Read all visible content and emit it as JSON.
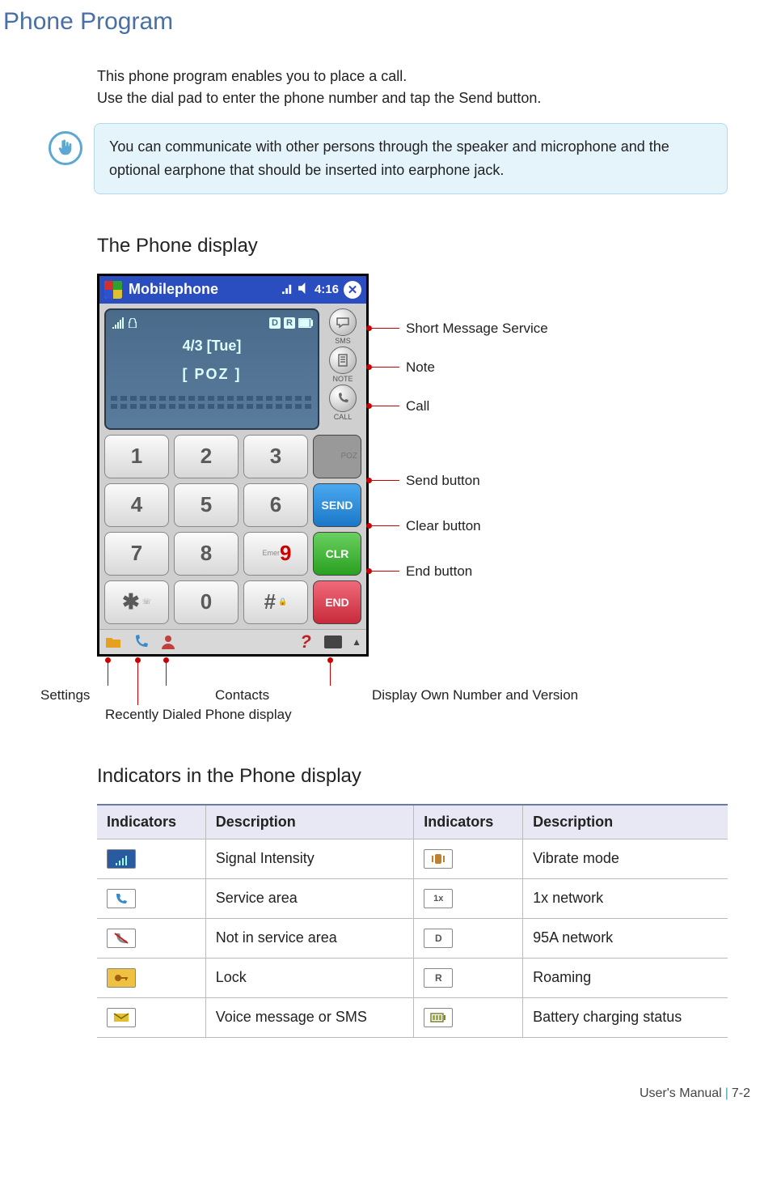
{
  "page": {
    "title": "Phone Program",
    "intro_line1": "This phone program enables you to place a call.",
    "intro_line2": "Use the dial pad to enter the phone number and tap the Send button.",
    "note_text": "You can communicate with other persons through the speaker and microphone and the optional earphone that should be inserted into earphone jack.",
    "section1": "The Phone display",
    "section2": "Indicators in the Phone display",
    "footer_left": "User's Manual",
    "footer_right": "7-2"
  },
  "phone": {
    "titlebar": {
      "app_name": "Mobilephone",
      "time": "4:16"
    },
    "lcd": {
      "date": "4/3 [Tue]",
      "brand": "[ POZ ]"
    },
    "side": {
      "sms": "SMS",
      "note": "NOTE",
      "call": "CALL",
      "brand": "POZ"
    },
    "keys": {
      "k1": "1",
      "k2": "2",
      "k3": "3",
      "k4": "4",
      "k5": "5",
      "k6": "6",
      "k7": "7",
      "k8": "8",
      "k9": "9",
      "k9sub": "Emer",
      "kstar": "✱",
      "k0": "0",
      "khash": "#"
    },
    "actions": {
      "send": "SEND",
      "clr": "CLR",
      "end": "END"
    }
  },
  "callouts": {
    "sms": "Short Message Service",
    "note": "Note",
    "call": "Call",
    "send": "Send button",
    "clr": "Clear button",
    "end": "End button",
    "settings": "Settings",
    "recent": "Recently Dialed Phone display",
    "contacts": "Contacts",
    "info": "Display Own Number and Version"
  },
  "table": {
    "h1": "Indicators",
    "h2": "Description",
    "h3": "Indicators",
    "h4": "Description",
    "rows": [
      {
        "d1": "Signal Intensity",
        "d2": "Vibrate mode"
      },
      {
        "d1": "Service area",
        "d2": "1x network"
      },
      {
        "d1": "Not in service area",
        "d2": "95A network"
      },
      {
        "d1": "Lock",
        "d2": "Roaming"
      },
      {
        "d1": "Voice message or SMS",
        "d2": "Battery charging status"
      }
    ]
  }
}
